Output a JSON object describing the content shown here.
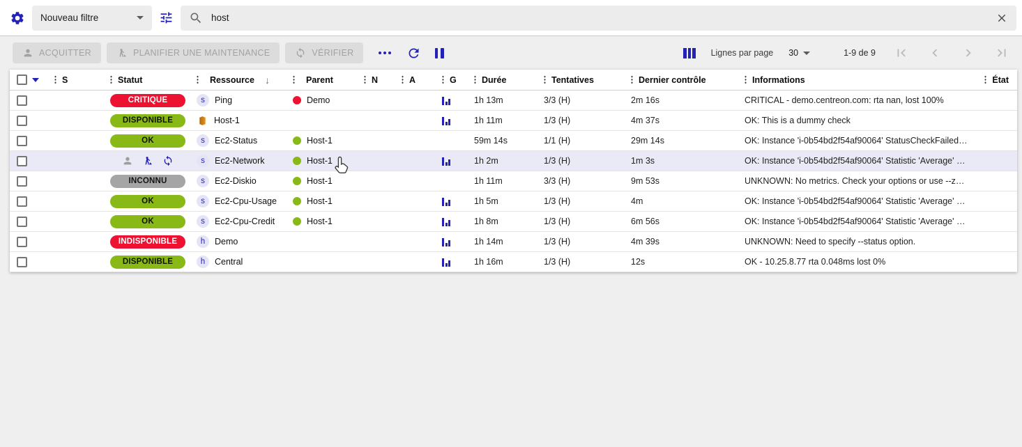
{
  "colors": {
    "accent": "#2421b6",
    "critical": "#ed1232",
    "ok": "#88b917",
    "unknown": "#a5a5a5",
    "chip_bg": "#e4e4f6",
    "row_highlight": "#eaeaf7"
  },
  "topbar": {
    "filter_value": "Nouveau filtre",
    "search_value": "host"
  },
  "toolbar": {
    "acquitter": "ACQUITTER",
    "maintenance": "PLANIFIER UNE MAINTENANCE",
    "verifier": "VÉRIFIER",
    "lines_per_page_label": "Lignes par page",
    "lines_per_page_value": "30",
    "pagination_range": "1-9 de 9"
  },
  "table": {
    "columns": [
      {
        "key": "s",
        "label": "S"
      },
      {
        "key": "statut",
        "label": "Statut"
      },
      {
        "key": "ressource",
        "label": "Ressource",
        "sorted": "desc"
      },
      {
        "key": "parent",
        "label": "Parent"
      },
      {
        "key": "n",
        "label": "N"
      },
      {
        "key": "a",
        "label": "A"
      },
      {
        "key": "g",
        "label": "G"
      },
      {
        "key": "duree",
        "label": "Durée"
      },
      {
        "key": "tentatives",
        "label": "Tentatives"
      },
      {
        "key": "dernier",
        "label": "Dernier contrôle"
      },
      {
        "key": "informations",
        "label": "Informations"
      },
      {
        "key": "etat",
        "label": "État"
      }
    ],
    "rows": [
      {
        "status_label": "CRITIQUE",
        "status_kind": "critical",
        "resource_kind": "service",
        "resource_name": "Ping",
        "parent_name": "Demo",
        "parent_status": "critical",
        "graph": true,
        "duration": "1h 13m",
        "tries": "3/3 (H)",
        "last_check": "2m 16s",
        "info": "CRITICAL - demo.centreon.com: rta nan, lost 100%"
      },
      {
        "status_label": "DISPONIBLE",
        "status_kind": "ok",
        "resource_kind": "aws-host",
        "resource_name": "Host-1",
        "parent_name": "",
        "graph": true,
        "duration": "1h 11m",
        "tries": "1/3 (H)",
        "last_check": "4m 37s",
        "info": "OK: This is a dummy check"
      },
      {
        "status_label": "OK",
        "status_kind": "ok",
        "resource_kind": "service",
        "resource_name": "Ec2-Status",
        "parent_name": "Host-1",
        "parent_status": "ok",
        "graph": false,
        "duration": "59m 14s",
        "tries": "1/1 (H)",
        "last_check": "29m 14s",
        "info": "OK: Instance 'i-0b54bd2f54af90064' StatusCheckFailed_…"
      },
      {
        "status_icons": [
          "acknowledged",
          "maintenance",
          "sync"
        ],
        "resource_kind": "service",
        "resource_name": "Ec2-Network",
        "parent_name": "Host-1",
        "parent_status": "ok",
        "graph": true,
        "duration": "1h 2m",
        "tries": "1/3 (H)",
        "last_check": "1m 3s",
        "info": "OK: Instance 'i-0b54bd2f54af90064' Statistic 'Average' M…",
        "highlighted": true
      },
      {
        "status_label": "INCONNU",
        "status_kind": "unknown",
        "resource_kind": "service",
        "resource_name": "Ec2-Diskio",
        "parent_name": "Host-1",
        "parent_status": "ok",
        "graph": false,
        "duration": "1h 11m",
        "tries": "3/3 (H)",
        "last_check": "9m 53s",
        "info": "UNKNOWN: No metrics. Check your options or use --zer…"
      },
      {
        "status_label": "OK",
        "status_kind": "ok",
        "resource_kind": "service",
        "resource_name": "Ec2-Cpu-Usage",
        "parent_name": "Host-1",
        "parent_status": "ok",
        "graph": true,
        "duration": "1h 5m",
        "tries": "1/3 (H)",
        "last_check": "4m",
        "info": "OK: Instance 'i-0b54bd2f54af90064' Statistic 'Average' M…"
      },
      {
        "status_label": "OK",
        "status_kind": "ok",
        "resource_kind": "service",
        "resource_name": "Ec2-Cpu-Credit",
        "parent_name": "Host-1",
        "parent_status": "ok",
        "graph": true,
        "duration": "1h 8m",
        "tries": "1/3 (H)",
        "last_check": "6m 56s",
        "info": "OK: Instance 'i-0b54bd2f54af90064' Statistic 'Average' M…"
      },
      {
        "status_label": "INDISPONIBLE",
        "status_kind": "critical",
        "resource_kind": "host",
        "resource_name": "Demo",
        "parent_name": "",
        "graph": true,
        "duration": "1h 14m",
        "tries": "1/3 (H)",
        "last_check": "4m 39s",
        "info": "UNKNOWN: Need to specify --status option."
      },
      {
        "status_label": "DISPONIBLE",
        "status_kind": "ok",
        "resource_kind": "host",
        "resource_name": "Central",
        "parent_name": "",
        "graph": true,
        "duration": "1h 16m",
        "tries": "1/3 (H)",
        "last_check": "12s",
        "info": "OK - 10.25.8.77 rta 0.048ms lost 0%"
      }
    ]
  }
}
